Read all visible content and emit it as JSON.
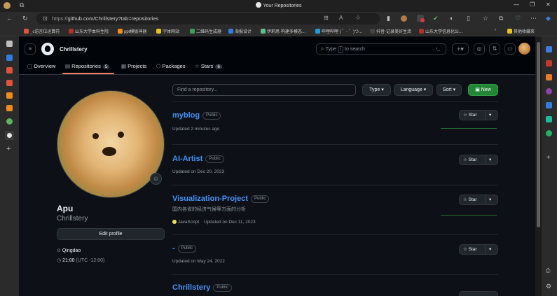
{
  "browser": {
    "window_title": "Your Repositories",
    "url_prefix": "https://",
    "url": "github.com/Chrillstery?tab=repositories",
    "bookmarks": [
      {
        "label": "_c语言位运算符",
        "color": "#e0533a"
      },
      {
        "label": "山东大学本科生院",
        "color": "#b0302a"
      },
      {
        "label": "ppt模板神器",
        "color": "#f08c1e"
      },
      {
        "label": "字体网站",
        "color": "#e8c21f"
      },
      {
        "label": "二维码生成器",
        "color": "#3aa05a"
      },
      {
        "label": "海报设计",
        "color": "#2f7de1"
      },
      {
        "label": "伊莉思·构建多模态...",
        "color": "#59c08a"
      },
      {
        "label": "哔哩哔哩 ( ゜- ゜)つ...",
        "color": "#1e9ed8"
      },
      {
        "label": "抖音-记录美好生活",
        "color": "#222222"
      },
      {
        "label": "山东大学信息化公...",
        "color": "#b0302a"
      },
      {
        "label": "其他收藏夹",
        "color": "#e8c21f"
      }
    ]
  },
  "header": {
    "username": "Chrillstery",
    "search_prefix": "Type",
    "search_key": "/",
    "search_suffix": "to search"
  },
  "tabs": [
    {
      "label": "Overview"
    },
    {
      "label": "Repositories",
      "count": "5"
    },
    {
      "label": "Projects"
    },
    {
      "label": "Packages"
    },
    {
      "label": "Stars",
      "count": "6"
    }
  ],
  "profile": {
    "display_name": "Apu",
    "login": "Chrillstery",
    "edit_label": "Edit profile",
    "location": "Qingdao",
    "time": "21:00",
    "timezone": "(UTC -12:00)"
  },
  "filters": {
    "search_placeholder": "Find a repository...",
    "type_label": "Type",
    "language_label": "Language",
    "sort_label": "Sort",
    "new_label": "New"
  },
  "repos": [
    {
      "name": "myblog",
      "visibility": "Public",
      "description": "",
      "language": "",
      "updated": "Updated 2 minutes ago",
      "star_label": "Star"
    },
    {
      "name": "AI-Artist",
      "visibility": "Public",
      "description": "",
      "language": "",
      "updated": "Updated on Dec 20, 2023",
      "star_label": "Star"
    },
    {
      "name": "Visualization-Project",
      "visibility": "Public",
      "description": "国内各省的经济气候等方面的分析",
      "language": "JavaScript",
      "language_color": "#f1e05a",
      "updated": "Updated on Dec 11, 2023",
      "star_label": "Star"
    },
    {
      "name": "-",
      "visibility": "Public",
      "description": "",
      "language": "",
      "updated": "Updated on May 24, 2022",
      "star_label": "Star"
    },
    {
      "name": "Chrillstery",
      "visibility": "Public",
      "description": "",
      "language": "",
      "updated": "",
      "star_label": ""
    }
  ],
  "colors": {
    "accent_link": "#4493f8",
    "new_button": "#238636",
    "page_bg": "#0d1117",
    "active_tab_underline": "#f78166"
  }
}
